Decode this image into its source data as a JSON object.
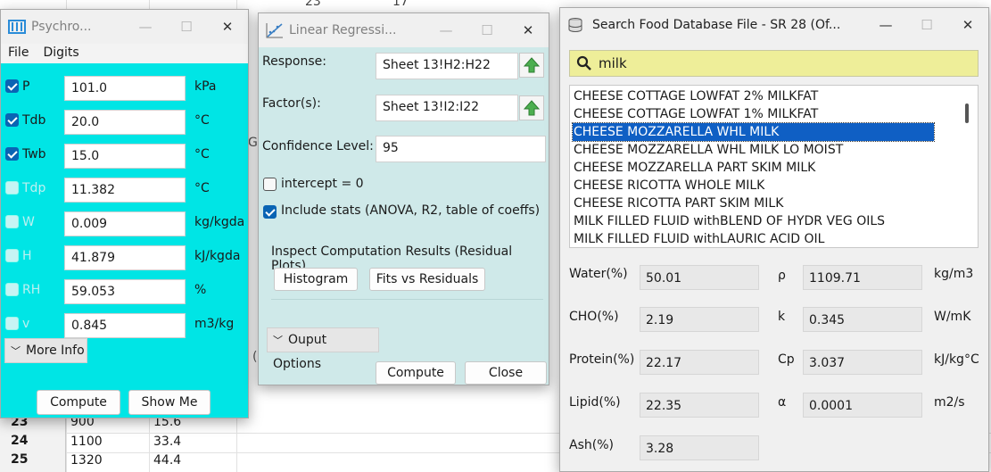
{
  "spreadsheet": {
    "top_values": [
      "23",
      "17"
    ],
    "partial_text": [
      "Gr",
      "("
    ],
    "rows": [
      {
        "row": "23",
        "a": "900",
        "b": "15.6"
      },
      {
        "row": "24",
        "a": "1100",
        "b": "33.4"
      },
      {
        "row": "25",
        "a": "1320",
        "b": "44.4"
      }
    ]
  },
  "psychro": {
    "title": "Psychro...",
    "menu": [
      "File",
      "Digits"
    ],
    "rows": [
      {
        "label": "P",
        "value": "101.0",
        "unit": "kPa",
        "checked": true
      },
      {
        "label": "Tdb",
        "value": "20.0",
        "unit": "°C",
        "checked": true
      },
      {
        "label": "Twb",
        "value": "15.0",
        "unit": "°C",
        "checked": true
      },
      {
        "label": "Tdp",
        "value": "11.382",
        "unit": "°C",
        "checked": false
      },
      {
        "label": "W",
        "value": "0.009",
        "unit": "kg/kgda",
        "checked": false
      },
      {
        "label": "H",
        "value": "41.879",
        "unit": "kJ/kgda",
        "checked": false
      },
      {
        "label": "RH",
        "value": "59.053",
        "unit": "%",
        "checked": false
      },
      {
        "label": "v",
        "value": "0.845",
        "unit": "m3/kg",
        "checked": false
      }
    ],
    "more_info": "More Info",
    "compute": "Compute",
    "show_me": "Show Me",
    "accent": "#00e5e5"
  },
  "regression": {
    "title": "Linear Regressi...",
    "response_label": "Response:",
    "response_value": "Sheet 13!H2:H22",
    "factors_label": "Factor(s):",
    "factors_value": "Sheet 13!I2:I22",
    "confidence_label": "Confidence Level:",
    "confidence_value": "95",
    "intercept_label": "intercept = 0",
    "intercept_checked": false,
    "stats_label": "Include stats (ANOVA, R2, table of coeffs)",
    "stats_checked": true,
    "inspect_label": "Inspect Computation Results (Residual Plots)",
    "histogram": "Histogram",
    "fits_vs_residuals": "Fits vs Residuals",
    "output_options": "Ouput Options",
    "compute": "Compute",
    "close": "Close",
    "background": "#cfe9e9"
  },
  "food": {
    "title": "Search Food Database File - SR 28 (Of...",
    "search_value": "milk",
    "items": [
      "CHEESE COTTAGE LOWFAT 2% MILKFAT",
      "CHEESE COTTAGE LOWFAT 1% MILKFAT",
      "CHEESE MOZZARELLA WHL MILK",
      "CHEESE MOZZARELLA WHL MILK LO MOIST",
      "CHEESE MOZZARELLA PART SKIM MILK",
      "CHEESE RICOTTA WHOLE MILK",
      "CHEESE RICOTTA PART SKIM MILK",
      "MILK FILLED FLUID withBLEND OF HYDR VEG OILS",
      "MILK FILLED FLUID withLAURIC ACID OIL"
    ],
    "selected_index": 2,
    "composition": [
      {
        "label": "Water(%)",
        "value": "50.01"
      },
      {
        "label": "CHO(%)",
        "value": "2.19"
      },
      {
        "label": "Protein(%)",
        "value": "22.17"
      },
      {
        "label": "Lipid(%)",
        "value": "22.35"
      },
      {
        "label": "Ash(%)",
        "value": "3.28"
      }
    ],
    "properties": [
      {
        "symbol": "ρ",
        "value": "1109.71",
        "unit": "kg/m3"
      },
      {
        "symbol": "k",
        "value": "0.345",
        "unit": "W/mK"
      },
      {
        "symbol": "Cp",
        "value": "3.037",
        "unit": "kJ/kg°C"
      },
      {
        "symbol": "α",
        "value": "0.0001",
        "unit": "m2/s"
      }
    ],
    "selection_color": "#0f5fc4",
    "search_bg": "#eeee99"
  }
}
